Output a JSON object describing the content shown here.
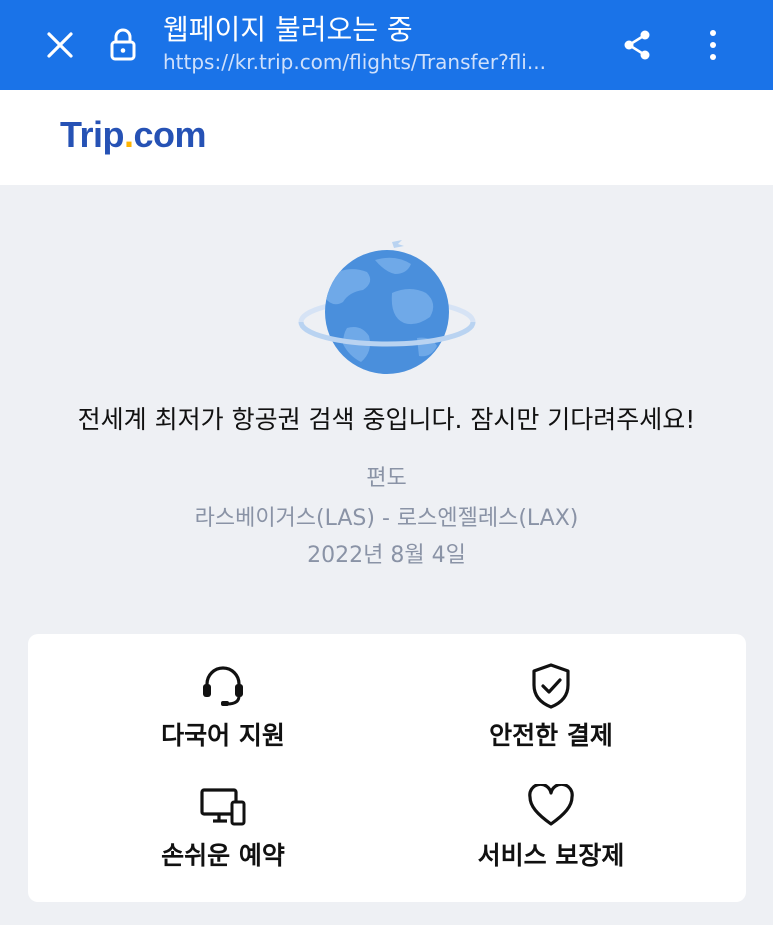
{
  "browser": {
    "title": "웹페이지 불러오는 중",
    "url": "https://kr.trip.com/flights/Transfer?fli..."
  },
  "logo": {
    "main": "Trip",
    "dot": ".",
    "suffix": "com"
  },
  "loading": {
    "message": "전세계 최저가 항공권 검색 중입니다. 잠시만 기다려주세요!",
    "trip_type": "편도",
    "route": "라스베이거스(LAS) - 로스엔젤레스(LAX)",
    "date": "2022년 8월 4일"
  },
  "features": [
    {
      "label": "다국어 지원",
      "icon": "headset-icon"
    },
    {
      "label": "안전한 결제",
      "icon": "shield-check-icon"
    },
    {
      "label": "손쉬운 예약",
      "icon": "devices-icon"
    },
    {
      "label": "서비스 보장제",
      "icon": "heart-icon"
    }
  ],
  "colors": {
    "browser_bar": "#1a73e8",
    "logo_blue": "#2652b5",
    "logo_dot": "#ffb400",
    "globe_blue": "#4a8fdc"
  }
}
